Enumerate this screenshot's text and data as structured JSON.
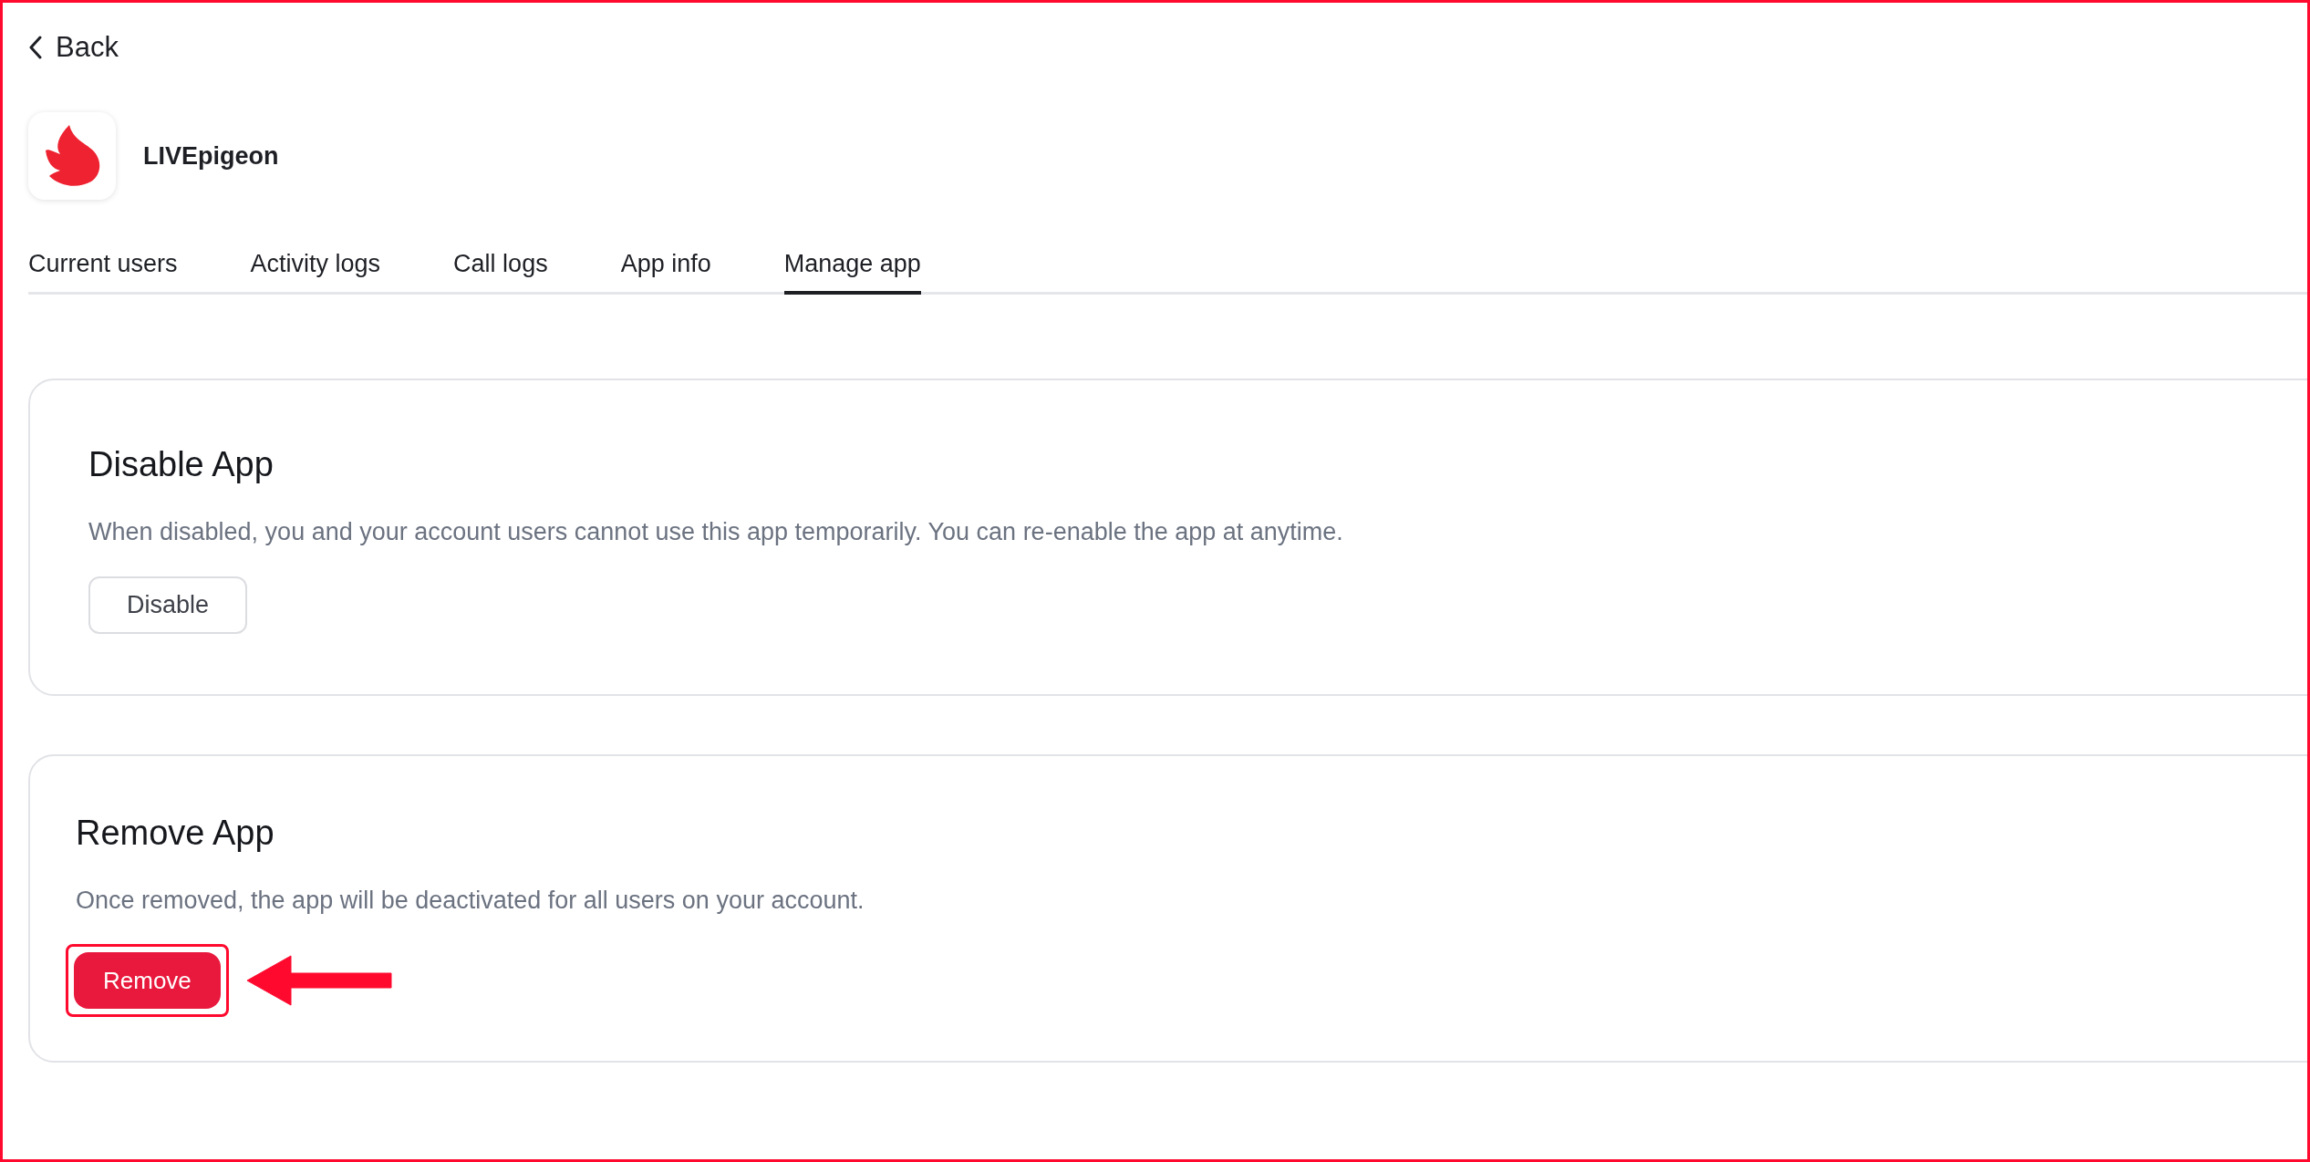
{
  "back": {
    "label": "Back"
  },
  "app": {
    "name": "LIVEpigeon"
  },
  "tabs": [
    {
      "label": "Current users",
      "selected": false
    },
    {
      "label": "Activity logs",
      "selected": false
    },
    {
      "label": "Call logs",
      "selected": false
    },
    {
      "label": "App info",
      "selected": false
    },
    {
      "label": "Manage app",
      "selected": true
    }
  ],
  "sections": [
    {
      "kind": "disable",
      "title": "Disable App",
      "description": "When disabled, you and your account users cannot use this app temporarily. You can re-enable the app at anytime.",
      "button": "Disable",
      "highlighted": false
    },
    {
      "kind": "remove",
      "title": "Remove App",
      "description": "Once removed, the app will be deactivated for all users on your account.",
      "button": "Remove",
      "highlighted": true
    }
  ]
}
